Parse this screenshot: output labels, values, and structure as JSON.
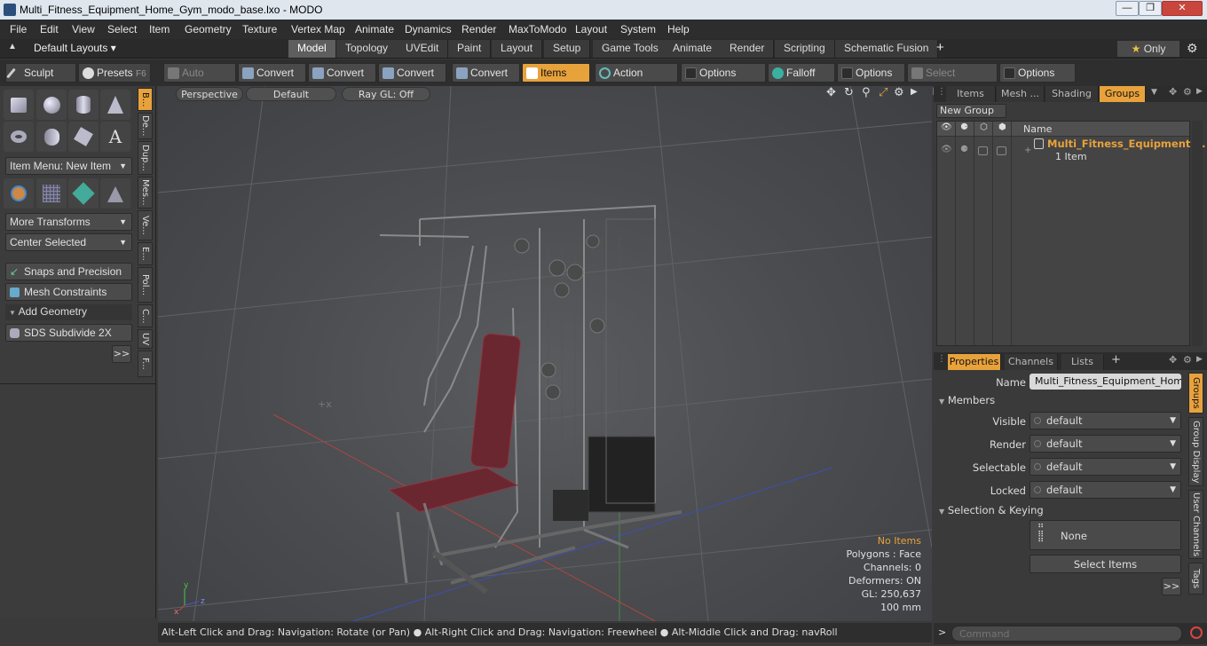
{
  "window": {
    "title": "Multi_Fitness_Equipment_Home_Gym_modo_base.lxo - MODO"
  },
  "menu": [
    "File",
    "Edit",
    "View",
    "Select",
    "Item",
    "Geometry",
    "Texture",
    "Vertex Map",
    "Animate",
    "Dynamics",
    "Render",
    "MaxToModo",
    "Layout",
    "System",
    "Help"
  ],
  "layouts": {
    "current": "Default Layouts",
    "tabs": [
      "Model",
      "Topology",
      "UVEdit",
      "Paint",
      "Layout",
      "Setup",
      "Game Tools",
      "Animate",
      "Render",
      "Scripting",
      "Schematic Fusion"
    ],
    "active": "Model",
    "only_label": "Only"
  },
  "toolbar": {
    "sculpt": "Sculpt",
    "presets": "Presets",
    "presets_key": "F6",
    "auto_select": "Auto Select",
    "convert1": "Convert",
    "convert2": "Convert",
    "convert3": "Convert",
    "convert4": "Convert",
    "items": "Items",
    "action_center": "Action Center",
    "options1": "Options",
    "falloff": "Falloff",
    "options2": "Options",
    "select_through": "Select Through",
    "options3": "Options"
  },
  "left": {
    "item_menu": "Item Menu: New Item",
    "more_transforms": "More Transforms",
    "center_selected": "Center Selected",
    "snaps": "Snaps and Precision",
    "mesh_constraints": "Mesh Constraints",
    "add_geometry": "Add Geometry",
    "sds": "SDS Subdivide 2X",
    "more": ">>",
    "vtabs": [
      "B...",
      "De...",
      "Dup...",
      "Mes...",
      "Ve...",
      "E...",
      "Pol...",
      "C...",
      "UV",
      "F..."
    ]
  },
  "viewport": {
    "perspective": "Perspective",
    "default": "Default",
    "raygl": "Ray GL: Off",
    "info": {
      "no_items": "No Items",
      "polygons": "Polygons : Face",
      "channels": "Channels: 0",
      "deformers": "Deformers: ON",
      "gl": "GL: 250,637",
      "scale": "100 mm"
    }
  },
  "status": "Alt-Left Click and Drag: Navigation: Rotate (or Pan) ● Alt-Right Click and Drag: Navigation: Freewheel ● Alt-Middle Click and Drag: navRoll",
  "right": {
    "tabs": [
      "Items",
      "Mesh ...",
      "Shading",
      "Groups"
    ],
    "new_group": "New Group",
    "col_name": "Name",
    "group_name": "Multi_Fitness_Equipment ...",
    "group_count": "1 Item",
    "prop_tabs": [
      "Properties",
      "Channels",
      "Lists"
    ],
    "name_label": "Name",
    "name_value": "Multi_Fitness_Equipment_Home_G",
    "members": "Members",
    "visible_label": "Visible",
    "visible": "default",
    "render_label": "Render",
    "render": "default",
    "selectable_label": "Selectable",
    "selectable": "default",
    "locked_label": "Locked",
    "locked": "default",
    "selection_keying": "Selection & Keying",
    "none": "None",
    "select_items": "Select Items",
    "more": ">>",
    "vtabs": [
      "Groups",
      "Group Display",
      "User Channels",
      "Tags"
    ],
    "command_placeholder": "Command"
  }
}
